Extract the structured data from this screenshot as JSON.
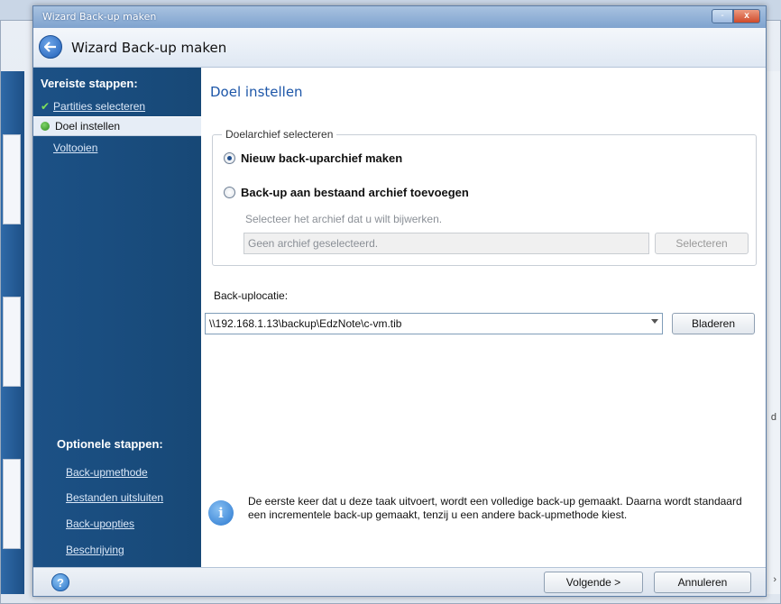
{
  "window": {
    "title": "Wizard Back-up maken",
    "header_title": "Wizard Back-up maken",
    "minimize_symbol": "-",
    "close_symbol": "x"
  },
  "sidebar": {
    "required_heading": "Vereiste stappen:",
    "required_items": [
      {
        "label": "Partities selecteren",
        "state": "done"
      },
      {
        "label": "Doel instellen",
        "state": "active"
      },
      {
        "label": "Voltooien",
        "state": "pending"
      }
    ],
    "optional_heading": "Optionele stappen:",
    "optional_items": [
      {
        "label": "Back-upmethode"
      },
      {
        "label": "Bestanden uitsluiten"
      },
      {
        "label": "Back-upopties"
      },
      {
        "label": "Beschrijving"
      }
    ]
  },
  "main": {
    "step_title": "Doel instellen",
    "archive_group": {
      "legend": "Doelarchief selecteren",
      "option_new": "Nieuw back-uparchief maken",
      "option_existing": "Back-up aan bestaand archief toevoegen",
      "selected": "new",
      "hint": "Selecteer het archief dat u wilt bijwerken.",
      "archive_field_value": "Geen archief geselecteerd.",
      "select_button": "Selecteren"
    },
    "location": {
      "label": "Back-uplocatie:",
      "value": "\\\\192.168.1.13\\backup\\EdzNote\\c-vm.tib",
      "browse_button": "Bladeren"
    },
    "info_text": "De eerste keer dat u deze taak uitvoert, wordt een volledige back-up gemaakt. Daarna wordt standaard een incrementele back-up gemaakt, tenzij u een andere back-upmethode kiest."
  },
  "footer": {
    "next_button": "Volgende >",
    "cancel_button": "Annuleren"
  },
  "icons": {
    "back": "back-arrow-icon",
    "help": "help-icon",
    "info": "info-icon",
    "check": "check-icon",
    "current_step": "arrow-icon"
  },
  "colors": {
    "sidebar": "#1c5186",
    "step_title": "#1d56a8",
    "titlebar": "#7fa3cf"
  }
}
